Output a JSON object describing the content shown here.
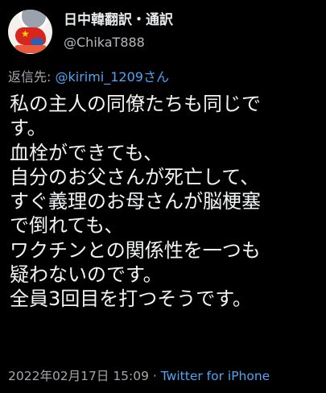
{
  "author": {
    "display_name": "日中韓翻訳・通訳",
    "handle": "@ChikaT888",
    "avatar_icon": "avatar-image"
  },
  "reply": {
    "prefix": "返信先: ",
    "target": "@kirimi_1209さん"
  },
  "tweet": {
    "lines": [
      "私の主人の同僚たちも同じで",
      "す。",
      "血栓ができても、",
      "自分のお父さんが死亡して、",
      "すぐ義理のお母さんが脳梗塞",
      "で倒れても、",
      "ワクチンとの関係性を一つも",
      "疑わないのです。",
      "全員3回目を打つそうです。"
    ]
  },
  "meta": {
    "timestamp": "2022年02月17日 15:09",
    "separator": " · ",
    "source": "Twitter for iPhone"
  },
  "colors": {
    "background": "#000000",
    "text": "#e7e9ea",
    "secondary": "#a3a8ad",
    "link": "#4ea6f1"
  }
}
